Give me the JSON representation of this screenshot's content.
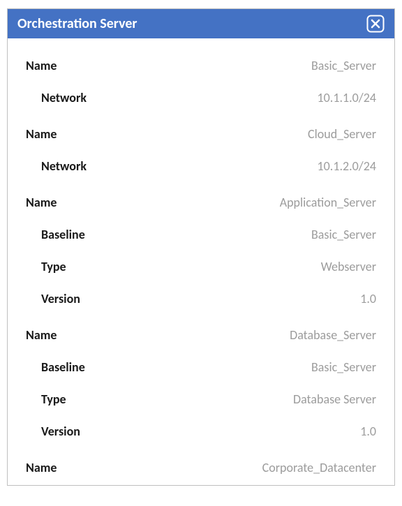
{
  "titlebar": {
    "title": "Orchestration Server"
  },
  "labels": {
    "name": "Name",
    "network": "Network",
    "baseline": "Baseline",
    "type": "Type",
    "version": "Version"
  },
  "entries": [
    {
      "name": "Basic_Server",
      "props": [
        {
          "key": "network",
          "value": "10.1.1.0/24"
        }
      ]
    },
    {
      "name": "Cloud_Server",
      "props": [
        {
          "key": "network",
          "value": "10.1.2.0/24"
        }
      ]
    },
    {
      "name": "Application_Server",
      "props": [
        {
          "key": "baseline",
          "value": "Basic_Server"
        },
        {
          "key": "type",
          "value": "Webserver"
        },
        {
          "key": "version",
          "value": "1.0"
        }
      ]
    },
    {
      "name": "Database_Server",
      "props": [
        {
          "key": "baseline",
          "value": "Basic_Server"
        },
        {
          "key": "type",
          "value": "Database Server"
        },
        {
          "key": "version",
          "value": "1.0"
        }
      ]
    },
    {
      "name": "Corporate_Datacenter",
      "props": []
    }
  ]
}
